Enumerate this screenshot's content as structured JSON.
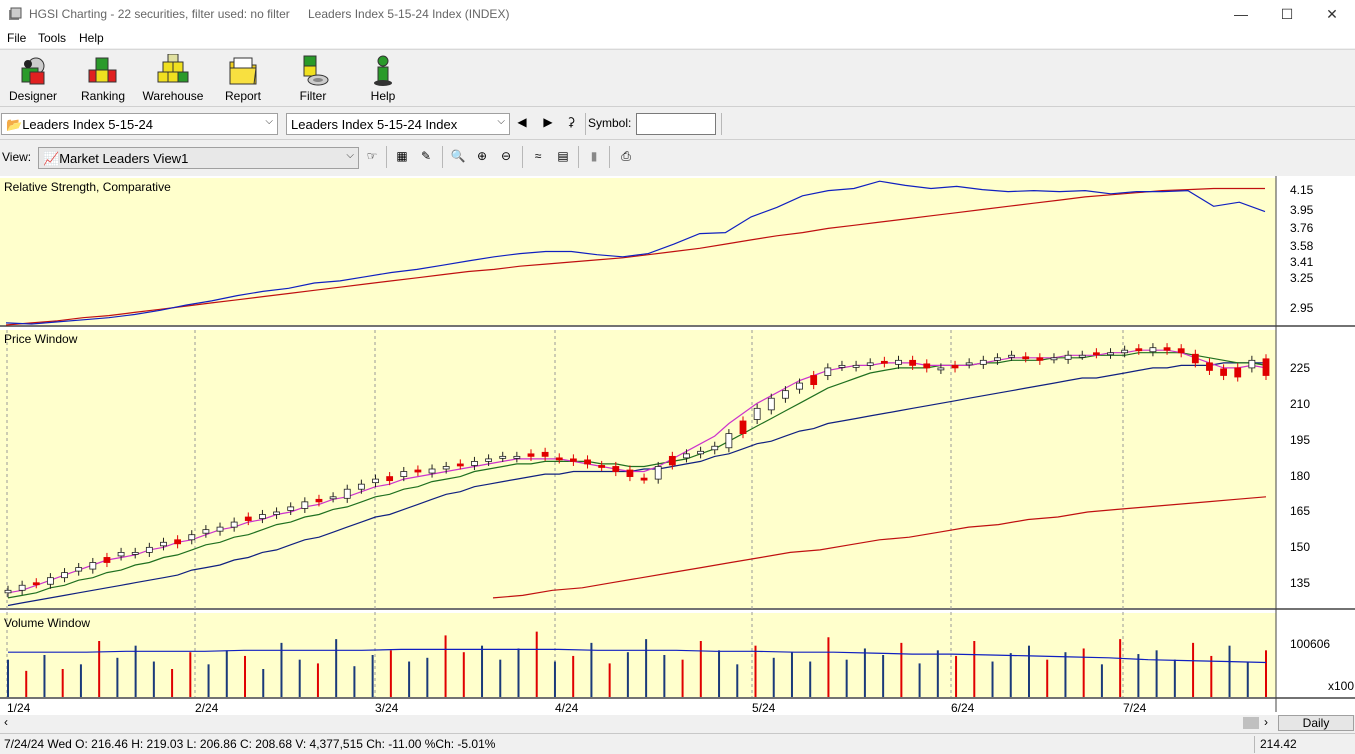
{
  "window": {
    "title": "HGSI Charting - 22 securities, filter used: no filter",
    "subtitle": "Leaders Index 5-15-24 Index (INDEX)",
    "minimize": "—",
    "maximize": "☐",
    "close": "✕"
  },
  "menu": [
    "File",
    "Tools",
    "Help"
  ],
  "toolbar": [
    {
      "label": "Designer",
      "icon": "designer-icon"
    },
    {
      "label": "Ranking",
      "icon": "ranking-icon"
    },
    {
      "label": "Warehouse",
      "icon": "warehouse-icon"
    },
    {
      "label": "Report",
      "icon": "report-icon"
    },
    {
      "label": "Filter",
      "icon": "filter-icon"
    },
    {
      "label": "Help",
      "icon": "help-icon"
    }
  ],
  "list_combo": "Leaders Index 5-15-24",
  "security_combo": "Leaders Index 5-15-24 Index",
  "symbol_label": "Symbol:",
  "symbol_value": "",
  "view_label": "View:",
  "view_combo": "Market Leaders View1",
  "panes": {
    "rs": "Relative Strength, Comparative",
    "price": "Price Window",
    "volume": "Volume Window"
  },
  "rs_ticks": [
    "4.15",
    "3.95",
    "3.76",
    "3.58",
    "3.41",
    "3.25",
    "2.95"
  ],
  "price_ticks": [
    "225",
    "210",
    "195",
    "180",
    "165",
    "150",
    "135"
  ],
  "volume_ticks": [
    "100606"
  ],
  "volume_multiplier": "x100",
  "x_ticks": [
    "1/24",
    "2/24",
    "3/24",
    "4/24",
    "5/24",
    "6/24",
    "7/24"
  ],
  "period_button": "Daily",
  "status": {
    "ohlc": "7/24/24 Wed O: 216.46 H: 219.03 L: 206.86 C: 208.68 V: 4,377,515 Ch: -11.00 %Ch: -5.01%",
    "cursor_value": "214.42"
  },
  "colors": {
    "chart_bg": "#ffffcc",
    "up": "#ffffff",
    "down": "#e00000",
    "rs_line": "#1020c0",
    "rs_ma": "#c01010",
    "ma_short": "#cc33cc",
    "ma_mid": "#207020",
    "ma_long": "#102080",
    "ma_200": "#c01010",
    "vol_up": "#1a3a7a",
    "vol_down": "#e00000"
  },
  "chart_data": [
    {
      "type": "line",
      "pane": "rs",
      "title": "Relative Strength, Comparative",
      "ylim": [
        2.85,
        4.25
      ],
      "series": [
        {
          "values": [
            2.87,
            2.86,
            2.88,
            2.9,
            2.92,
            2.95,
            2.99,
            3.04,
            3.08,
            3.13,
            3.17,
            3.2,
            3.25,
            3.27,
            3.31,
            3.35,
            3.38,
            3.42,
            3.46,
            3.5,
            3.53,
            3.55,
            3.55,
            3.52,
            3.5,
            3.53,
            3.62,
            3.72,
            3.73,
            3.88,
            3.97,
            4.08,
            4.13,
            4.15,
            4.22,
            4.18,
            4.15,
            4.17,
            4.14,
            4.12,
            4.13,
            4.12,
            4.13,
            4.1,
            4.12,
            4.12,
            4.13,
            3.98,
            4.02,
            3.93
          ]
        },
        {
          "values": [
            2.85,
            2.87,
            2.89,
            2.92,
            2.94,
            2.97,
            3.0,
            3.03,
            3.06,
            3.09,
            3.12,
            3.15,
            3.18,
            3.21,
            3.24,
            3.27,
            3.3,
            3.33,
            3.36,
            3.38,
            3.41,
            3.43,
            3.45,
            3.47,
            3.49,
            3.52,
            3.55,
            3.58,
            3.62,
            3.66,
            3.7,
            3.73,
            3.77,
            3.8,
            3.83,
            3.86,
            3.89,
            3.92,
            3.95,
            3.98,
            4.01,
            4.04,
            4.07,
            4.09,
            4.11,
            4.13,
            4.14,
            4.15,
            4.15,
            4.15
          ]
        }
      ]
    },
    {
      "type": "candlestick",
      "pane": "price",
      "title": "Price Window",
      "ylim": [
        124,
        234
      ],
      "x": [
        "1/24",
        "2/24",
        "3/24",
        "4/24",
        "5/24",
        "6/24",
        "7/24"
      ],
      "close": [
        131,
        133,
        134,
        136,
        138,
        140,
        142,
        144,
        146,
        146,
        148,
        150,
        151,
        153,
        155,
        156,
        158,
        160,
        161,
        162,
        164,
        166,
        167,
        168,
        171,
        173,
        175,
        176,
        178,
        178,
        179,
        180,
        181,
        182,
        183,
        184,
        184,
        185,
        184,
        183,
        182,
        181,
        180,
        178,
        176,
        175,
        180,
        184,
        185,
        186,
        188,
        193,
        198,
        203,
        207,
        210,
        213,
        216,
        219,
        220,
        220,
        221,
        221,
        222,
        220,
        219,
        219,
        220,
        221,
        222,
        223,
        224,
        223,
        222,
        223,
        224,
        224,
        225,
        225,
        226,
        226,
        227,
        226,
        225,
        221,
        218,
        216,
        219,
        222,
        216
      ],
      "ma_short": [
        130,
        131,
        133,
        135,
        137,
        139,
        141,
        143,
        144,
        145,
        147,
        148,
        150,
        151,
        153,
        155,
        156,
        158,
        159,
        161,
        162,
        164,
        165,
        167,
        168,
        170,
        172,
        173,
        175,
        176,
        177,
        178,
        179,
        180,
        181,
        182,
        183,
        183,
        183,
        183,
        182,
        181,
        180,
        179,
        178,
        178,
        180,
        183,
        186,
        189,
        192,
        197,
        201,
        205,
        208,
        211,
        214,
        216,
        218,
        219,
        220,
        220,
        221,
        221,
        221,
        220,
        220,
        220,
        220,
        221,
        222,
        223,
        223,
        223,
        223,
        224,
        224,
        224,
        225,
        225,
        226,
        226,
        226,
        225,
        223,
        221,
        219,
        219,
        220,
        219
      ],
      "ma_mid": [
        128,
        129,
        130,
        132,
        133,
        135,
        136,
        138,
        139,
        141,
        142,
        144,
        145,
        147,
        149,
        150,
        152,
        153,
        155,
        157,
        158,
        160,
        161,
        163,
        164,
        166,
        168,
        169,
        171,
        172,
        174,
        175,
        176,
        178,
        179,
        180,
        181,
        181,
        182,
        182,
        182,
        182,
        181,
        181,
        180,
        180,
        181,
        182,
        183,
        185,
        187,
        190,
        193,
        196,
        199,
        202,
        205,
        208,
        211,
        213,
        215,
        217,
        218,
        219,
        219,
        219,
        220,
        220,
        220,
        221,
        221,
        222,
        222,
        222,
        223,
        223,
        223,
        224,
        224,
        224,
        225,
        225,
        225,
        225,
        224,
        223,
        222,
        221,
        221,
        220
      ],
      "ma_long": [
        125,
        126,
        127,
        128,
        129,
        130,
        131,
        132,
        133,
        134,
        135,
        136,
        137,
        139,
        140,
        141,
        143,
        144,
        146,
        147,
        149,
        151,
        152,
        154,
        156,
        158,
        160,
        161,
        163,
        165,
        167,
        169,
        170,
        172,
        173,
        174,
        175,
        176,
        177,
        177,
        178,
        178,
        178,
        178,
        178,
        179,
        179,
        180,
        181,
        182,
        184,
        185,
        187,
        189,
        190,
        192,
        194,
        195,
        197,
        198,
        199,
        200,
        201,
        202,
        203,
        204,
        205,
        206,
        207,
        208,
        209,
        210,
        211,
        212,
        213,
        214,
        215,
        215,
        216,
        217,
        218,
        219,
        219,
        220,
        220,
        220,
        221,
        221,
        221,
        221
      ],
      "ma_200": [
        128,
        129,
        131,
        132,
        134,
        136,
        138,
        140,
        142,
        144,
        146,
        147,
        149,
        151,
        152,
        154,
        156,
        157,
        159,
        160,
        162,
        163,
        164,
        165,
        166,
        167,
        168
      ]
    },
    {
      "type": "bar",
      "pane": "volume",
      "title": "Volume Window",
      "values": [
        40,
        28,
        45,
        30,
        35,
        60,
        42,
        55,
        38,
        30,
        48,
        35,
        50,
        44,
        30,
        58,
        40,
        36,
        62,
        33,
        45,
        50,
        38,
        42,
        66,
        48,
        55,
        40,
        52,
        70,
        38,
        44,
        58,
        36,
        48,
        62,
        45,
        40,
        60,
        50,
        35,
        55,
        42,
        48,
        38,
        64,
        40,
        52,
        45,
        58,
        36,
        50,
        44,
        60,
        38,
        47,
        55,
        40,
        48,
        52,
        35,
        62,
        46,
        50,
        40,
        58,
        44,
        55,
        38,
        50
      ],
      "ma": [
        48,
        48,
        48,
        49,
        49,
        49,
        50,
        50,
        50,
        50,
        51,
        51,
        51,
        51,
        51,
        50,
        50,
        50,
        49,
        49,
        48,
        48,
        47,
        46,
        46,
        45,
        44,
        43,
        42,
        40,
        39,
        38,
        37
      ]
    }
  ]
}
